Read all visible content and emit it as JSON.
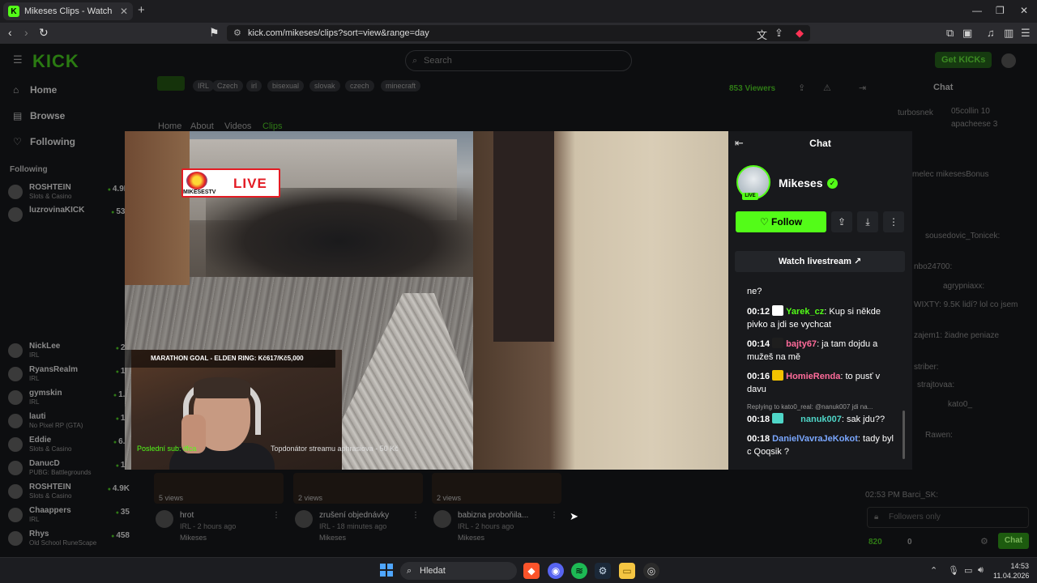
{
  "browser": {
    "tab_title": "Mikeses Clips - Watch Live on Kick",
    "url": "kick.com/mikeses/clips?sort=view&range=day"
  },
  "topnav": {
    "logo": "KICK",
    "search_placeholder": "Search",
    "get_kicks": "Get KICKs"
  },
  "sidebar": {
    "home": "Home",
    "browse": "Browse",
    "following": "Following",
    "section_title": "Following",
    "channels": [
      {
        "name": "ROSHTEIN",
        "category": "Slots & Casino",
        "viewers": "4.9K"
      },
      {
        "name": "luzrovinaKICK",
        "category": "",
        "viewers": "534"
      },
      {
        "name": "NickLee",
        "category": "IRL",
        "viewers": "27"
      },
      {
        "name": "RyansRealm",
        "category": "IRL",
        "viewers": "12"
      },
      {
        "name": "gymskin",
        "category": "IRL",
        "viewers": "1.4"
      },
      {
        "name": "lauti",
        "category": "No Pixel RP (GTA)",
        "viewers": "12"
      },
      {
        "name": "Eddie",
        "category": "Slots & Casino",
        "viewers": "6.2"
      },
      {
        "name": "DanucD",
        "category": "PUBG: Battlegrounds",
        "viewers": "10"
      },
      {
        "name": "ROSHTEIN",
        "category": "Slots & Casino",
        "viewers": "4.9K"
      },
      {
        "name": "Chaappers",
        "category": "IRL",
        "viewers": "35"
      },
      {
        "name": "Rhys",
        "category": "Old School RuneScape",
        "viewers": "458"
      }
    ]
  },
  "channel": {
    "tags": [
      "IRL",
      "Czech",
      "irl",
      "bisexual",
      "slovak",
      "czech",
      "minecraft"
    ],
    "viewers": "853 Viewers",
    "tabs": [
      "Home",
      "About",
      "Videos",
      "Clips"
    ]
  },
  "clips": [
    {
      "views": "5 views",
      "title": "hrot",
      "meta": "IRL - 2 hours ago",
      "user": "Mikeses"
    },
    {
      "views": "2 views",
      "title": "zrušení objednávky",
      "meta": "IRL - 18 minutes ago",
      "user": "Mikeses"
    },
    {
      "views": "2 views",
      "title": "babizna proboňila...",
      "meta": "IRL - 2 hours ago",
      "user": "Mikeses"
    }
  ],
  "bg_chat": {
    "title": "Chat",
    "lines": [
      "turbosnek",
      "05collin  10",
      "apacheese  3",
      "melec mikesesBonus",
      "sousedovic_Tonicek:",
      "nbo24700:",
      "agrypniaxx:",
      "WIXTY: 9.5K lidí? lol co jsem",
      "zajem1: žiadne peniaze",
      "striber:",
      "strajtovaa:",
      "kato0_",
      "Rawen:",
      "02:53 PM Barci_SK:"
    ],
    "followers_only": "Followers only",
    "points": "820",
    "points2": "0",
    "chat_button": "Chat"
  },
  "video": {
    "live_label": "LIVE",
    "brand": "MIKESESTV",
    "goal_text": "MARATHON GOAL - ELDEN RING: Kč617/Kč5,000",
    "bottom_left": "Poslední sub: iffca",
    "bottom_center": "Topdonátor streamu aphrasiova - 50 Kč"
  },
  "modal_chat": {
    "title": "Chat",
    "channel_name": "Mikeses",
    "live_badge": "LIVE",
    "follow": "Follow",
    "watch": "Watch livestream",
    "partial_top": "ne?",
    "messages": [
      {
        "time": "00:12",
        "user": "Yarek_cz",
        "color": "#53fc18",
        "text": ": Kup si někde pivko a jdi se vychcat"
      },
      {
        "time": "00:14",
        "user": "bajty67",
        "color": "#ff6b9a",
        "text": ": ja tam dojdu a mužeš na mě"
      },
      {
        "time": "00:16",
        "user": "HomieRenda",
        "color": "#ff6b9a",
        "text": ": to pusť v davu"
      },
      {
        "time": "00:18",
        "user": "nanuk007",
        "color": "#4fd6c8",
        "text": ": sak jdu??"
      },
      {
        "time": "00:18",
        "user": "DanielVavraJeKokot",
        "color": "#7aa7ff",
        "text": ": tady byl c Qoqsik ?"
      }
    ],
    "reply": "Replying to kato0_real: @nanuk007 jdi na..."
  },
  "taskbar": {
    "search": "Hledat",
    "time": "14:53",
    "date": "11.04.2026"
  }
}
